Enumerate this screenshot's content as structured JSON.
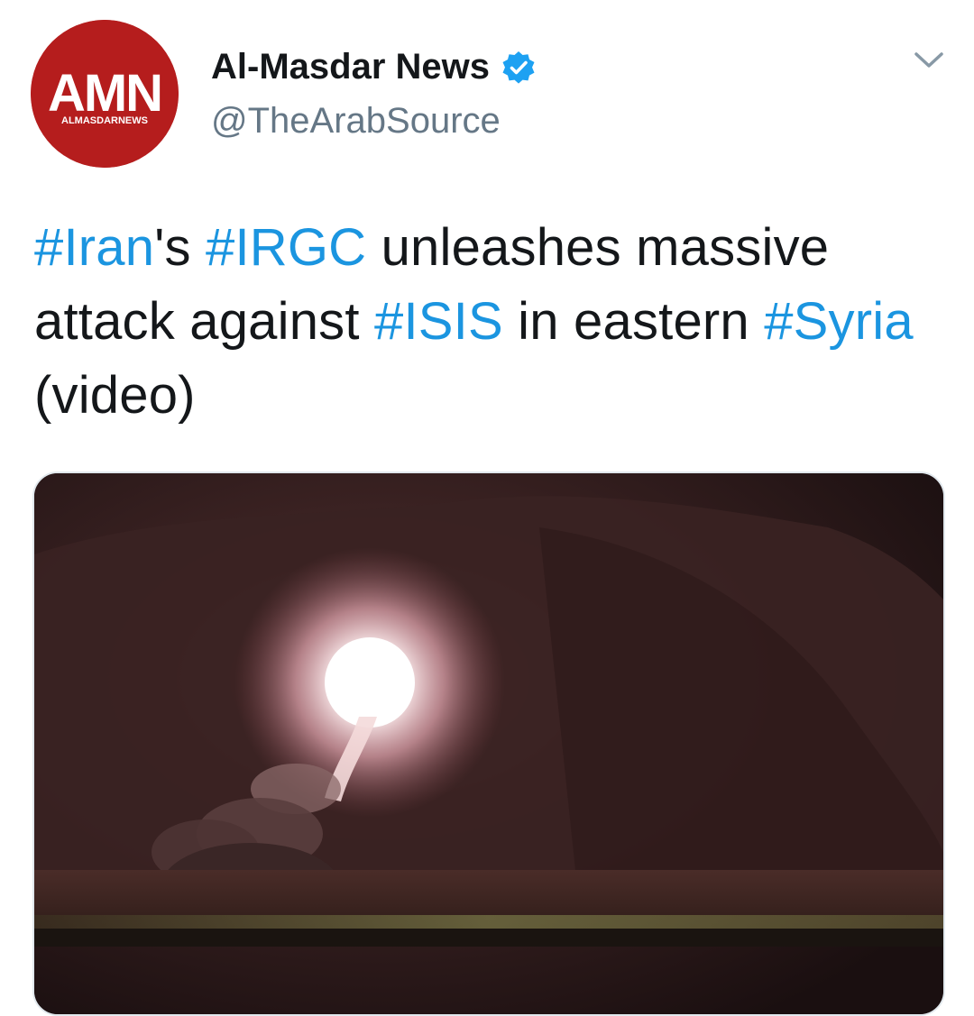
{
  "account": {
    "avatar_text": "AMN",
    "avatar_subtext": "ALMASDARNEWS",
    "display_name": "Al-Masdar News",
    "handle": "@TheArabSource",
    "verified": true
  },
  "tweet": {
    "segments": [
      {
        "text": "#Iran",
        "type": "hashtag"
      },
      {
        "text": "'s ",
        "type": "text"
      },
      {
        "text": "#IRGC",
        "type": "hashtag"
      },
      {
        "text": " unleashes massive attack against ",
        "type": "text"
      },
      {
        "text": "#ISIS",
        "type": "hashtag"
      },
      {
        "text": " in eastern ",
        "type": "text"
      },
      {
        "text": "#Syria",
        "type": "hashtag"
      },
      {
        "text": " (video)",
        "type": "text"
      }
    ]
  },
  "media": {
    "type": "photo",
    "description_icon": "missile-launch-photo"
  },
  "colors": {
    "link": "#1b95e0",
    "text": "#14171a",
    "secondary": "#657786",
    "avatar_red": "#b11c1c",
    "verified_blue": "#1da1f2"
  }
}
